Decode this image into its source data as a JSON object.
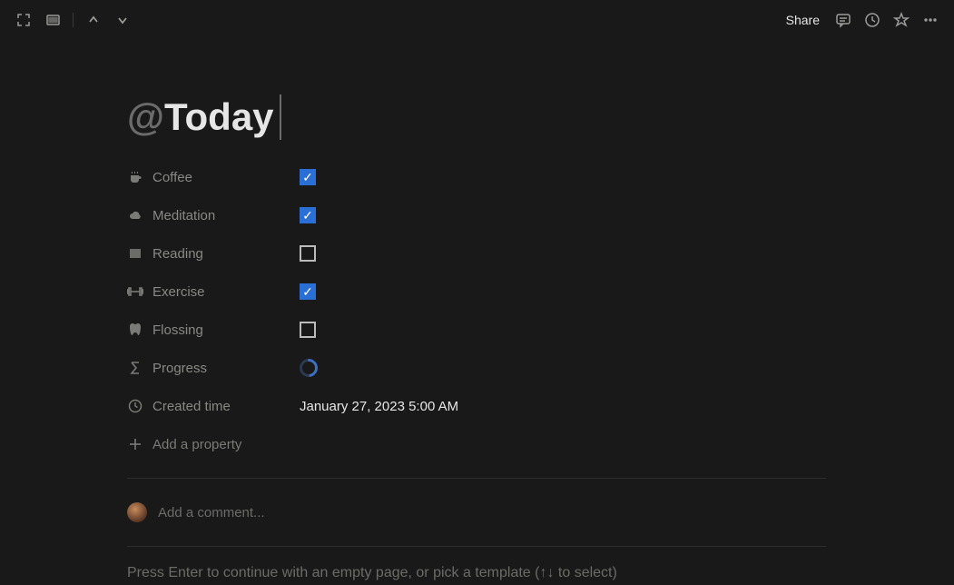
{
  "topbar": {
    "share_label": "Share"
  },
  "title": {
    "prefix": "@",
    "text": "Today"
  },
  "properties": [
    {
      "icon": "coffee",
      "label": "Coffee",
      "type": "checkbox",
      "checked": true
    },
    {
      "icon": "cloud",
      "label": "Meditation",
      "type": "checkbox",
      "checked": true
    },
    {
      "icon": "book",
      "label": "Reading",
      "type": "checkbox",
      "checked": false
    },
    {
      "icon": "barbell",
      "label": "Exercise",
      "type": "checkbox",
      "checked": true
    },
    {
      "icon": "tooth",
      "label": "Flossing",
      "type": "checkbox",
      "checked": false
    },
    {
      "icon": "sigma",
      "label": "Progress",
      "type": "ring",
      "value": null
    },
    {
      "icon": "clock",
      "label": "Created time",
      "type": "text",
      "value": "January 27, 2023 5:00 AM"
    }
  ],
  "add_property_label": "Add a property",
  "comment": {
    "placeholder": "Add a comment..."
  },
  "body_hint": "Press Enter to continue with an empty page, or pick a template (↑↓ to select)"
}
